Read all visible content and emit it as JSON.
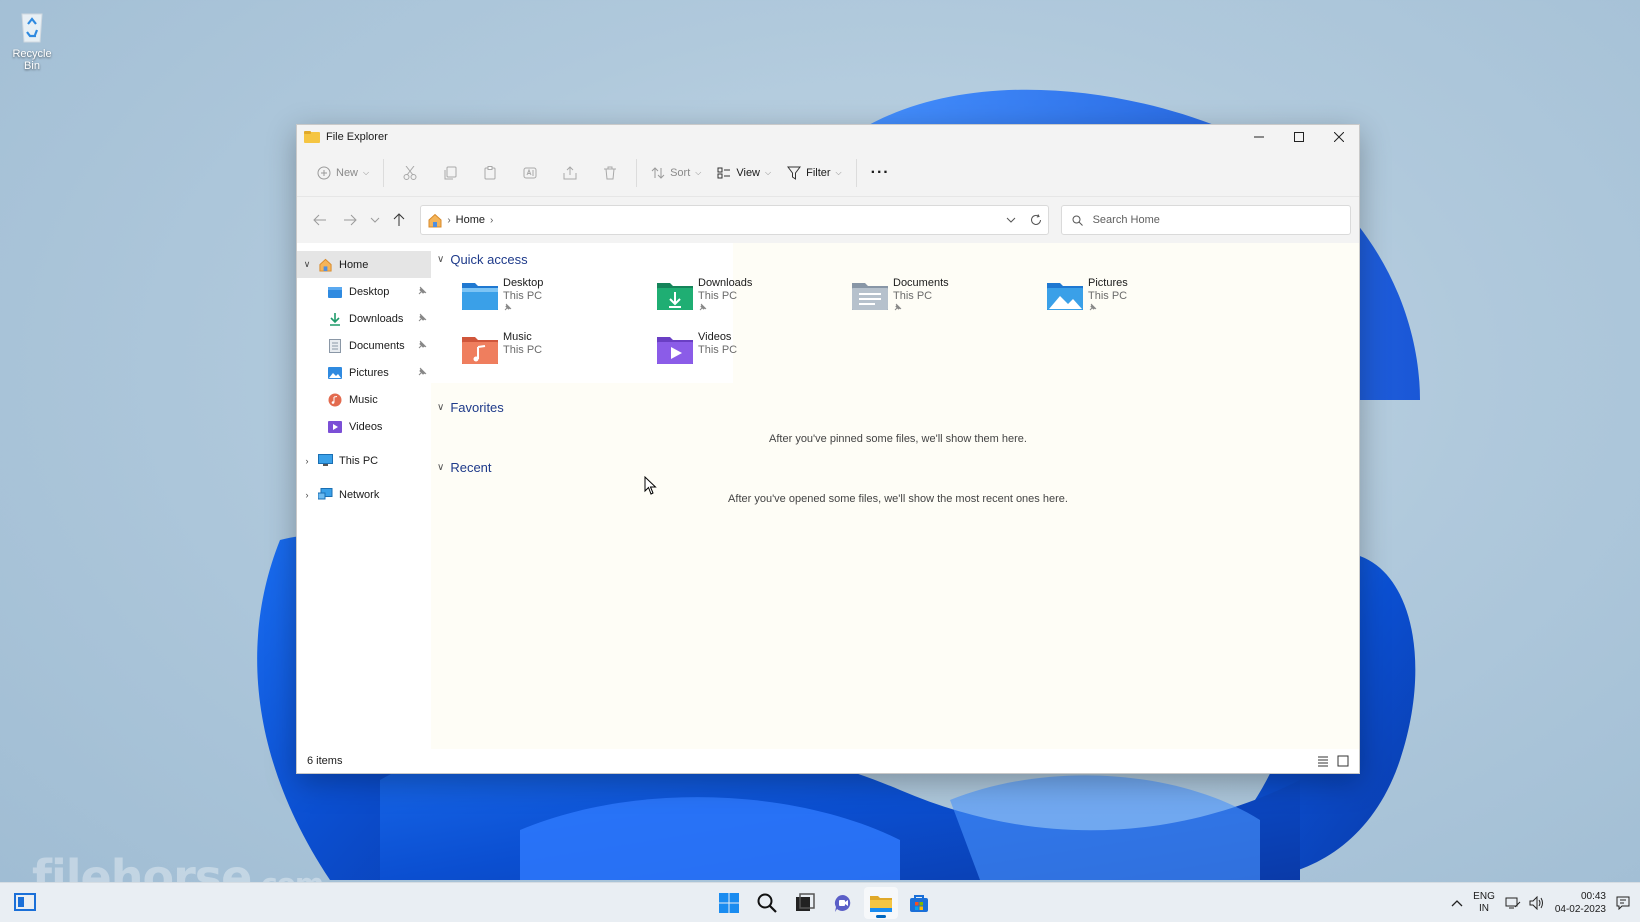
{
  "desktop": {
    "recycle_bin_label": "Recycle Bin",
    "watermark": "filehorse",
    "watermark_suffix": ".com"
  },
  "window": {
    "title": "File Explorer",
    "controls": {
      "minimize": "minimize-icon",
      "maximize": "maximize-icon",
      "close": "close-icon"
    }
  },
  "toolbar": {
    "new_label": "New",
    "sort_label": "Sort",
    "view_label": "View",
    "filter_label": "Filter",
    "more_label": "···"
  },
  "navigation": {
    "breadcrumb": [
      "Home"
    ],
    "search_placeholder": "Search Home"
  },
  "sidebar": {
    "items": [
      {
        "label": "Home",
        "icon": "home-icon",
        "expanded": true,
        "active": true
      },
      {
        "label": "Desktop",
        "icon": "desktop-folder-icon",
        "pinned": true
      },
      {
        "label": "Downloads",
        "icon": "downloads-folder-icon",
        "pinned": true
      },
      {
        "label": "Documents",
        "icon": "documents-folder-icon",
        "pinned": true
      },
      {
        "label": "Pictures",
        "icon": "pictures-folder-icon",
        "pinned": true
      },
      {
        "label": "Music",
        "icon": "music-folder-icon",
        "pinned": false
      },
      {
        "label": "Videos",
        "icon": "videos-folder-icon",
        "pinned": false
      },
      {
        "label": "This PC",
        "icon": "this-pc-icon",
        "expanded": false
      },
      {
        "label": "Network",
        "icon": "network-icon",
        "expanded": false
      }
    ]
  },
  "main": {
    "quick_access_title": "Quick access",
    "quick_access": [
      {
        "name": "Desktop",
        "location": "This PC",
        "pinned": true
      },
      {
        "name": "Downloads",
        "location": "This PC",
        "pinned": true
      },
      {
        "name": "Documents",
        "location": "This PC",
        "pinned": true
      },
      {
        "name": "Pictures",
        "location": "This PC",
        "pinned": true
      },
      {
        "name": "Music",
        "location": "This PC",
        "pinned": false
      },
      {
        "name": "Videos",
        "location": "This PC",
        "pinned": false
      }
    ],
    "favorites_title": "Favorites",
    "favorites_empty": "After you've pinned some files, we'll show them here.",
    "recent_title": "Recent",
    "recent_empty": "After you've opened some files, we'll show the most recent ones here."
  },
  "status": {
    "item_count": "6 items"
  },
  "taskbar": {
    "lang_top": "ENG",
    "lang_bottom": "IN",
    "time": "00:43",
    "date": "04-02-2023"
  },
  "colors": {
    "accent": "#0067c0",
    "section_title": "#1e3a8a",
    "folder_yellow": "#f5c542"
  }
}
